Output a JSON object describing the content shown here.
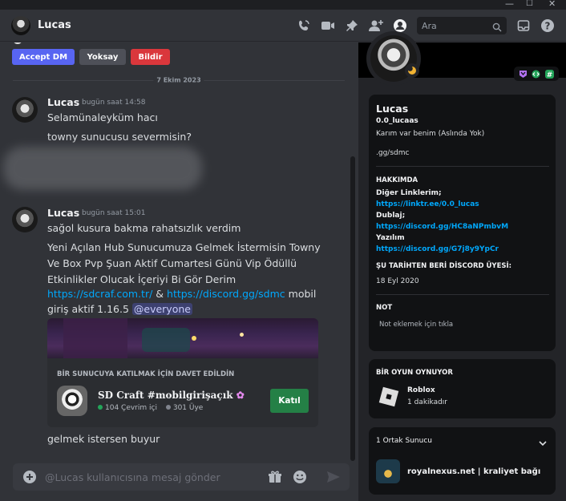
{
  "header": {
    "title": "Lucas",
    "search_placeholder": "Ara"
  },
  "dm_actions": {
    "accept": "Accept DM",
    "ignore": "Yoksay",
    "report": "Bildir"
  },
  "date_divider": "7 Ekim 2023",
  "messages": [
    {
      "author": "Lucas",
      "time": "bugün saat 14:58",
      "lines": [
        "Selamünaleyküm hacı",
        "towny sunucusu severmisin?"
      ]
    },
    {
      "author": "Lucas",
      "time": "bugün saat 15:01",
      "lines": [
        "sağol kusura bakma rahatsızlık verdim",
        "Yeni Açılan Hub Sunucumuza Gelmek İstermisin Towny",
        "Ve Box Pvp Şuan Aktif Cumartesi Günü Vip Ödüllü",
        "Etkinlikler Olucak İçeriyi Bi Gör Derim"
      ],
      "link1": "https://sdcraf.com.tr/",
      "amp": " & ",
      "link2": "https://discord.gg/sdmc",
      "after_link": " mobil",
      "line6_text": "giriş aktif 1.16.5 ",
      "mention": "@everyone"
    }
  ],
  "invite": {
    "heading": "BİR SUNUCUYA KATILMAK İÇİN DAVET EDİLDİN",
    "server_name": "SD Craft #mobilgirişaçık",
    "online": "104 Çevrim içi",
    "members": "301 Üye",
    "join": "Katıl"
  },
  "last_message": "gelmek istersen buyur",
  "composer": {
    "placeholder": "@Lucas kullanıcısına mesaj gönder"
  },
  "profile": {
    "display_name": "Lucas",
    "username": "0.0_lucaas",
    "custom_status": "Karım var benim (Aslında Yok)",
    "extra": ".gg/sdmc",
    "about_heading": "HAKKIMDA",
    "about_lines": [
      {
        "text": "Diğer Linklerim;",
        "kind": "label"
      },
      {
        "text": "https://linktr.ee/0.0_lucas",
        "kind": "link"
      },
      {
        "text": "Dublaj;",
        "kind": "label"
      },
      {
        "text": "https://discord.gg/HC8aNPmbvM",
        "kind": "link"
      },
      {
        "text": "Yazılım",
        "kind": "label"
      },
      {
        "text": "https://discord.gg/G7j8y9YpCr",
        "kind": "link"
      }
    ],
    "member_since_heading": "ŞU TARİHTEN BERİ DİSCORD ÜYESİ:",
    "member_since": "18 Eyl 2020",
    "note_heading": "NOT",
    "note_placeholder": "Not eklemek için tıkla",
    "playing_heading": "BİR OYUN OYNUYOR",
    "game_name": "Roblox",
    "game_time": "1 dakikadır",
    "mutual_heading": "1 Ortak Sunucu",
    "mutual_server": "royalnexus.net | kraliyet bağı"
  },
  "colors": {
    "accent": "#5865f2",
    "link": "#00a8fc",
    "danger": "#da373c",
    "success": "#248046"
  }
}
